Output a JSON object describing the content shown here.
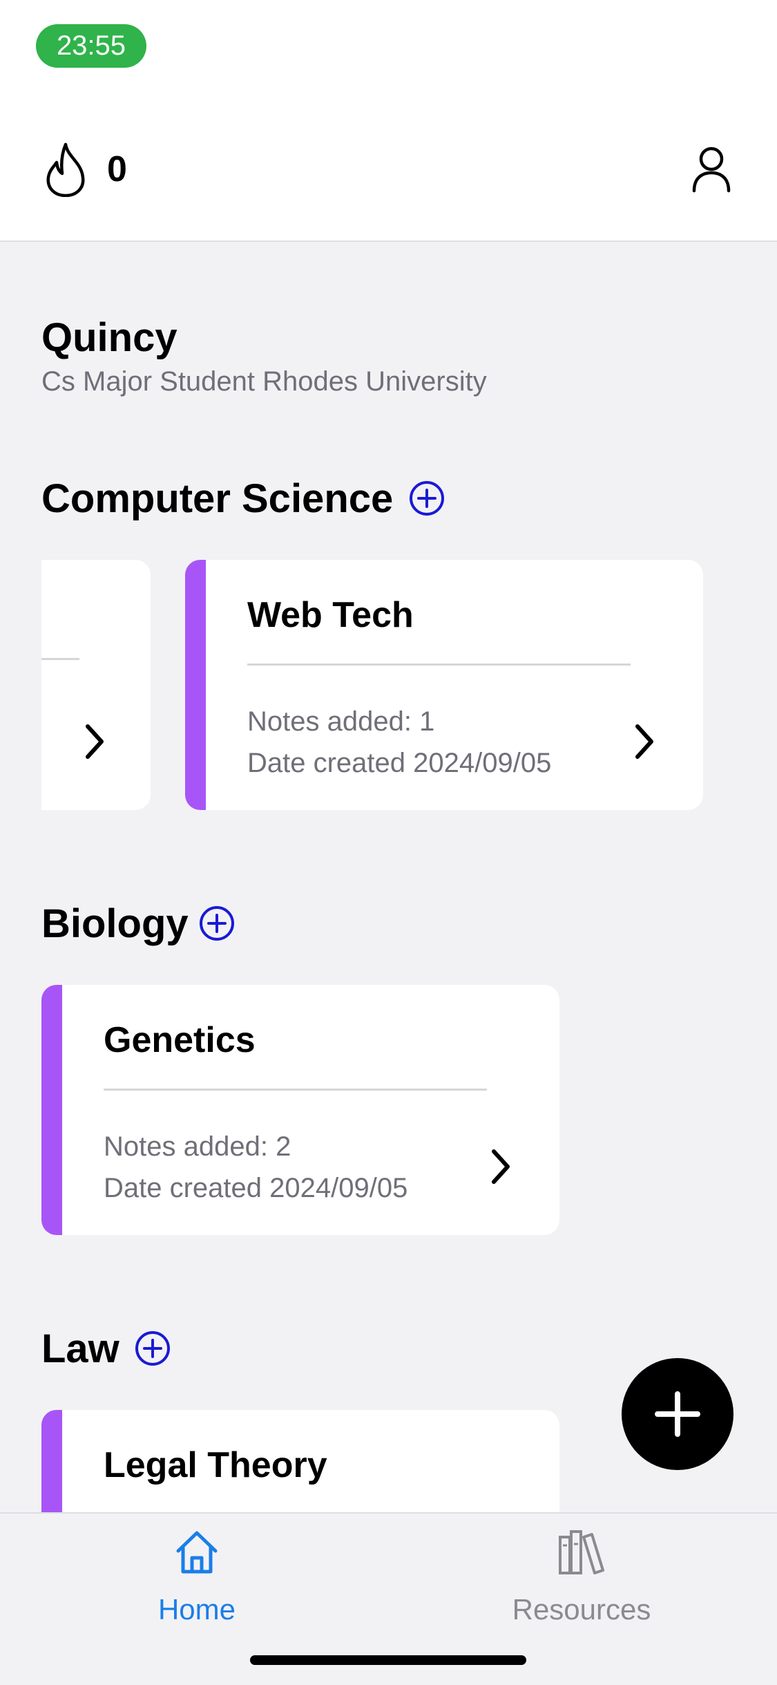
{
  "status_bar": {
    "time": "23:55"
  },
  "header": {
    "streak_count": "0",
    "icons": [
      "flame-icon",
      "profile-icon"
    ]
  },
  "profile": {
    "name": "Quincy",
    "subtitle": "Cs Major Student Rhodes University"
  },
  "sections": [
    {
      "title": "Computer Science",
      "cards": [
        {
          "title": "",
          "notes": "",
          "date": ""
        },
        {
          "title": "Web Tech",
          "notes": "Notes added: 1",
          "date": "Date created 2024/09/05"
        }
      ]
    },
    {
      "title": "Biology",
      "cards": [
        {
          "title": "Genetics",
          "notes": "Notes added: 2",
          "date": "Date created 2024/09/05"
        }
      ]
    },
    {
      "title": "Law",
      "cards": [
        {
          "title": "Legal Theory"
        }
      ]
    }
  ],
  "tab_bar": {
    "tabs": [
      {
        "label": "Home",
        "icon": "home-icon",
        "active": true
      },
      {
        "label": "Resources",
        "icon": "books-icon",
        "active": false
      }
    ]
  },
  "colors": {
    "accent": "#a855f7",
    "active_tab": "#1a7ee8",
    "inactive_tab": "#8a8a90",
    "plus": "#1a1ad6",
    "status_pill": "#2fb34a"
  }
}
